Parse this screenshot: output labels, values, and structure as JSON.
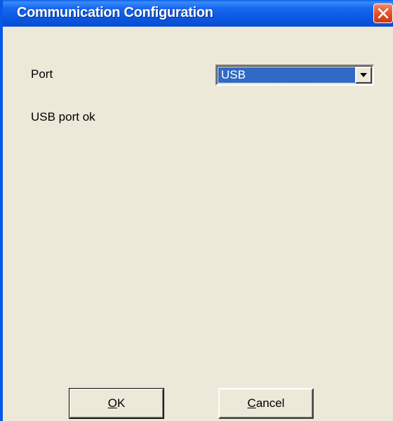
{
  "window": {
    "title": "Communication Configuration",
    "close_icon": "close-icon"
  },
  "form": {
    "port_label": "Port",
    "port_select": {
      "selected": "USB",
      "arrow_icon": "chevron-down-icon"
    },
    "status": "USB port ok"
  },
  "buttons": {
    "ok": {
      "mnemonic": "O",
      "rest": "K"
    },
    "cancel": {
      "mnemonic": "C",
      "rest": "ancel"
    }
  },
  "colors": {
    "titlebar": "#0a56e0",
    "dialog_bg": "#ece9d8",
    "selection": "#316ac5",
    "close_button": "#e3532c"
  }
}
